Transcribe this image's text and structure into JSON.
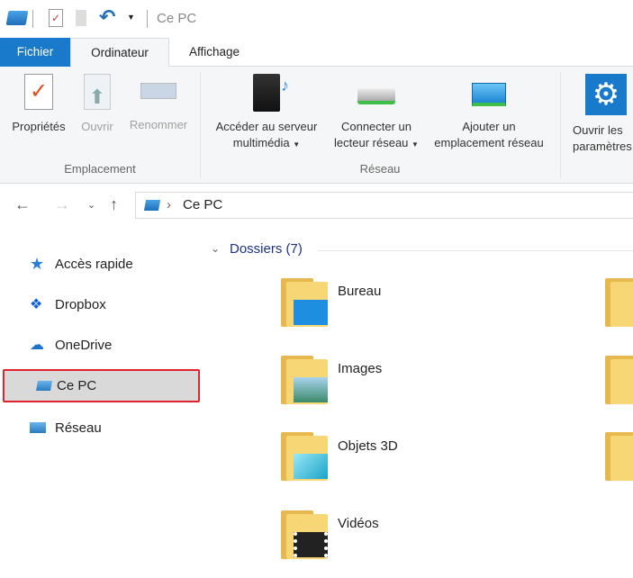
{
  "title_bar": {
    "title": "Ce PC"
  },
  "tabs": [
    {
      "label": "Fichier"
    },
    {
      "label": "Ordinateur"
    },
    {
      "label": "Affichage"
    }
  ],
  "ribbon": {
    "groups": [
      {
        "label": "Emplacement",
        "buttons": [
          {
            "label": "Propriétés"
          },
          {
            "label": "Ouvrir"
          },
          {
            "label": "Renommer"
          }
        ]
      },
      {
        "label": "Réseau",
        "buttons": [
          {
            "line1": "Accéder au serveur",
            "line2": "multimédia"
          },
          {
            "line1": "Connecter un",
            "line2": "lecteur réseau"
          },
          {
            "line1": "Ajouter un",
            "line2": "emplacement réseau"
          }
        ]
      },
      {
        "label": "",
        "buttons": [
          {
            "line1": "Ouvrir les",
            "line2": "paramètres"
          }
        ]
      }
    ]
  },
  "address": {
    "path": "Ce PC",
    "separator": "›"
  },
  "nav_pane": [
    {
      "label": "Accès rapide"
    },
    {
      "label": "Dropbox"
    },
    {
      "label": "OneDrive"
    },
    {
      "label": "Ce PC"
    },
    {
      "label": "Réseau"
    }
  ],
  "main": {
    "section": "Dossiers (7)",
    "folders": [
      {
        "label": "Bureau"
      },
      {
        "label": "Images"
      },
      {
        "label": "Objets 3D"
      },
      {
        "label": "Vidéos"
      }
    ]
  },
  "colors": {
    "accent": "#1979ca",
    "highlight_border": "#e0232e"
  }
}
